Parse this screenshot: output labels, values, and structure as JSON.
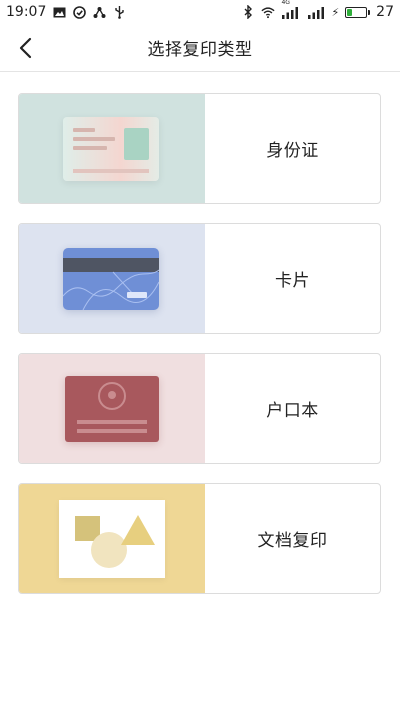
{
  "status_bar": {
    "time": "19:07",
    "left_icons": [
      "image-notification-icon",
      "check-circle-icon",
      "share-icon",
      "usb-icon"
    ],
    "right_icons": [
      "bluetooth-icon",
      "wifi-icon",
      "signal-4g-icon",
      "signal-icon",
      "charging-icon"
    ],
    "network_label": "4G",
    "battery_level": 27,
    "battery_text": "27"
  },
  "header": {
    "title": "选择复印类型",
    "back_icon": "chevron-left-icon"
  },
  "options": [
    {
      "label": "身份证",
      "icon": "id-card-icon",
      "accent": "#d0e2df"
    },
    {
      "label": "卡片",
      "icon": "bank-card-icon",
      "accent": "#dde3f0"
    },
    {
      "label": "户口本",
      "icon": "household-register-icon",
      "accent": "#f0dfe0"
    },
    {
      "label": "文档复印",
      "icon": "document-icon",
      "accent": "#efd795"
    }
  ],
  "colors": {
    "bank_card": "#6f8fd6",
    "hukou_cover": "#a8585d",
    "battery_fill": "#2fae3a"
  }
}
